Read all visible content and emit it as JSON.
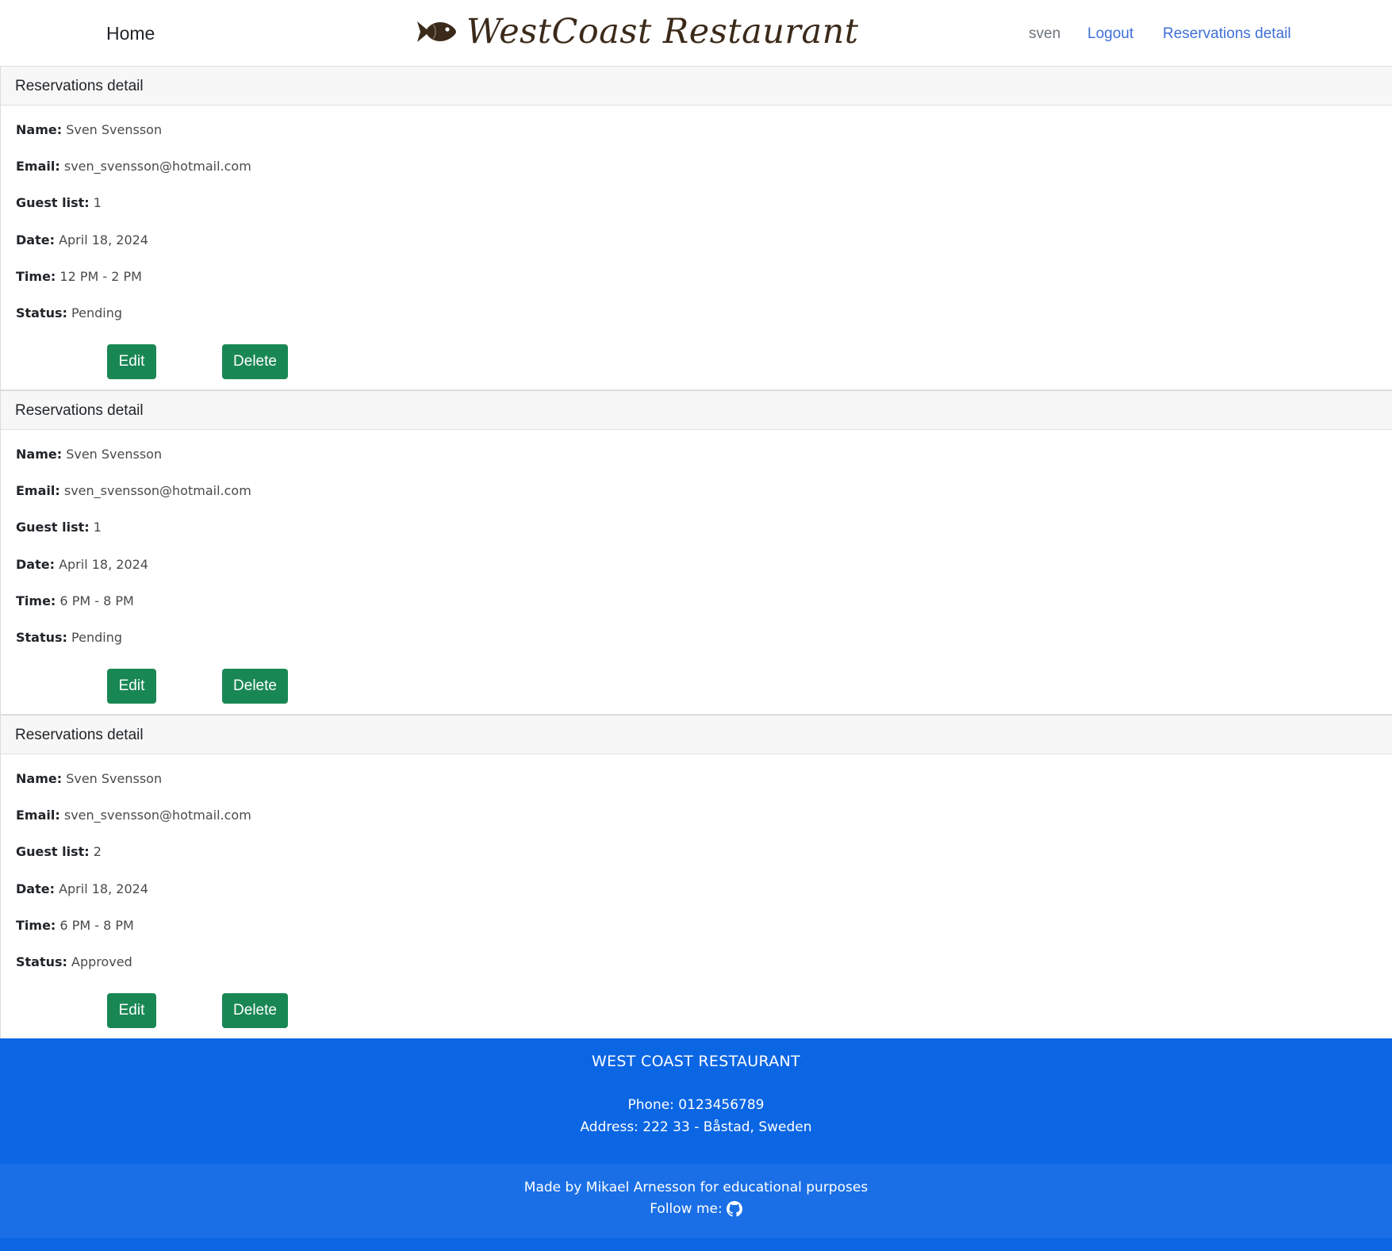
{
  "navbar": {
    "home_label": "Home",
    "brand_name": "WestCoast Restaurant",
    "brand_icon": "fish-icon",
    "username": "sven",
    "logout_label": "Logout",
    "reservations_label": "Reservations detail"
  },
  "labels": {
    "name": "Name:",
    "email": "Email:",
    "guest_list": "Guest list:",
    "date": "Date:",
    "time": "Time:",
    "status": "Status:"
  },
  "reservations": [
    {
      "header": "Reservations detail",
      "name": "Sven Svensson",
      "email": "sven_svensson@hotmail.com",
      "guest_list": "1",
      "date": "April 18, 2024",
      "time": "12 PM - 2 PM",
      "status": "Pending",
      "edit_label": "Edit",
      "delete_label": "Delete"
    },
    {
      "header": "Reservations detail",
      "name": "Sven Svensson",
      "email": "sven_svensson@hotmail.com",
      "guest_list": "1",
      "date": "April 18, 2024",
      "time": "6 PM - 8 PM",
      "status": "Pending",
      "edit_label": "Edit",
      "delete_label": "Delete"
    },
    {
      "header": "Reservations detail",
      "name": "Sven Svensson",
      "email": "sven_svensson@hotmail.com",
      "guest_list": "2",
      "date": "April 18, 2024",
      "time": "6 PM - 8 PM",
      "status": "Approved",
      "edit_label": "Edit",
      "delete_label": "Delete"
    }
  ],
  "footer": {
    "title": "WEST COAST RESTAURANT",
    "phone": "Phone: 0123456789",
    "address": "Address: 222 33 - Båstad, Sweden",
    "made_by": "Made by Mikael Arnesson for educational purposes",
    "follow_label": "Follow me:",
    "follow_icon": "github-icon"
  },
  "colors": {
    "button_green": "#198754",
    "link_blue": "#3f6fd8",
    "footer_blue": "#0b66e4",
    "footer_blue_light": "#1a6fe6",
    "brand_brown": "#3b2a1a"
  }
}
